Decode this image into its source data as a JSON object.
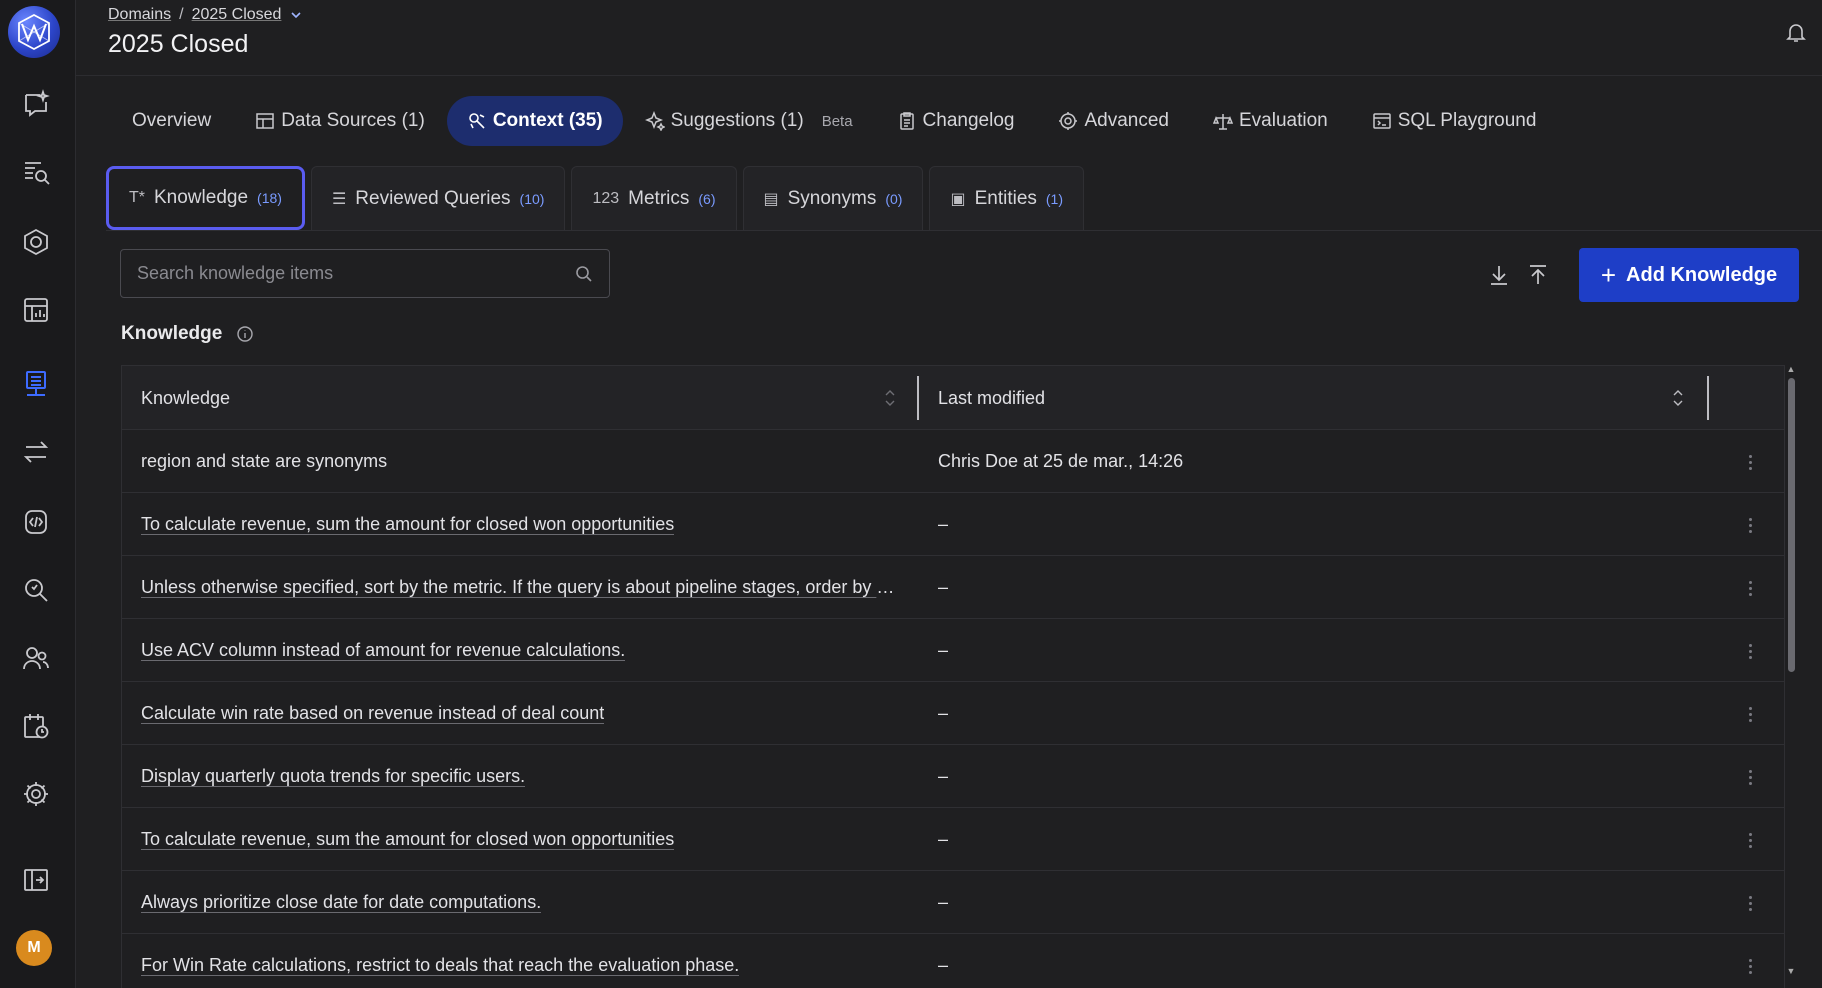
{
  "breadcrumb": {
    "root": "Domains",
    "separator": "/",
    "current": "2025 Closed"
  },
  "page": {
    "title": "2025 Closed"
  },
  "main_tabs": [
    {
      "label": "Overview",
      "icon": ""
    },
    {
      "label": "Data Sources (1)",
      "icon": "data-sources-icon"
    },
    {
      "label": "Context (35)",
      "icon": "context-icon",
      "active": true
    },
    {
      "label": "Suggestions (1)",
      "icon": "sparkle-icon",
      "badge": "Beta"
    },
    {
      "label": "Changelog",
      "icon": "clipboard-icon"
    },
    {
      "label": "Advanced",
      "icon": "gear-icon"
    },
    {
      "label": "Evaluation",
      "icon": "scale-icon"
    },
    {
      "label": "SQL Playground",
      "icon": "sql-icon"
    }
  ],
  "sub_tabs": [
    {
      "icon_text": "T*",
      "label": "Knowledge",
      "count": "(18)",
      "active": true
    },
    {
      "icon_text": "☰",
      "label": "Reviewed Queries",
      "count": "(10)"
    },
    {
      "icon_text": "123",
      "label": "Metrics",
      "count": "(6)"
    },
    {
      "icon_text": "▤",
      "label": "Synonyms",
      "count": "(0)"
    },
    {
      "icon_text": "▣",
      "label": "Entities",
      "count": "(1)"
    }
  ],
  "search": {
    "placeholder": "Search knowledge items"
  },
  "actions": {
    "add_label": "Add Knowledge"
  },
  "section": {
    "title": "Knowledge"
  },
  "table": {
    "columns": [
      "Knowledge",
      "Last modified"
    ],
    "rows": [
      {
        "knowledge": "region and state are synonyms",
        "modified": "Chris Doe at 25 de mar., 14:26"
      },
      {
        "knowledge": "To calculate revenue, sum the amount for closed won opportunities",
        "modified": "–"
      },
      {
        "knowledge": "Unless otherwise specified, sort by the metric. If the query is about pipeline stages, order by pipeli...",
        "modified": "–"
      },
      {
        "knowledge": "Use ACV column instead of amount for revenue calculations.",
        "modified": "–"
      },
      {
        "knowledge": "Calculate win rate based on revenue instead of deal count",
        "modified": "–"
      },
      {
        "knowledge": "Display quarterly quota trends for specific users.",
        "modified": "–"
      },
      {
        "knowledge": "To calculate revenue, sum the amount for closed won opportunities",
        "modified": "–"
      },
      {
        "knowledge": "Always prioritize close date for date computations.",
        "modified": "–"
      },
      {
        "knowledge": "For Win Rate calculations, restrict to deals that reach the evaluation phase.",
        "modified": "–"
      }
    ]
  },
  "user": {
    "avatar_initial": "M"
  },
  "colors": {
    "accent": "#1e3ec7",
    "active_tab": "#1d2d6e",
    "focus_ring": "#5a5cf0",
    "avatar": "#d98a1e"
  }
}
